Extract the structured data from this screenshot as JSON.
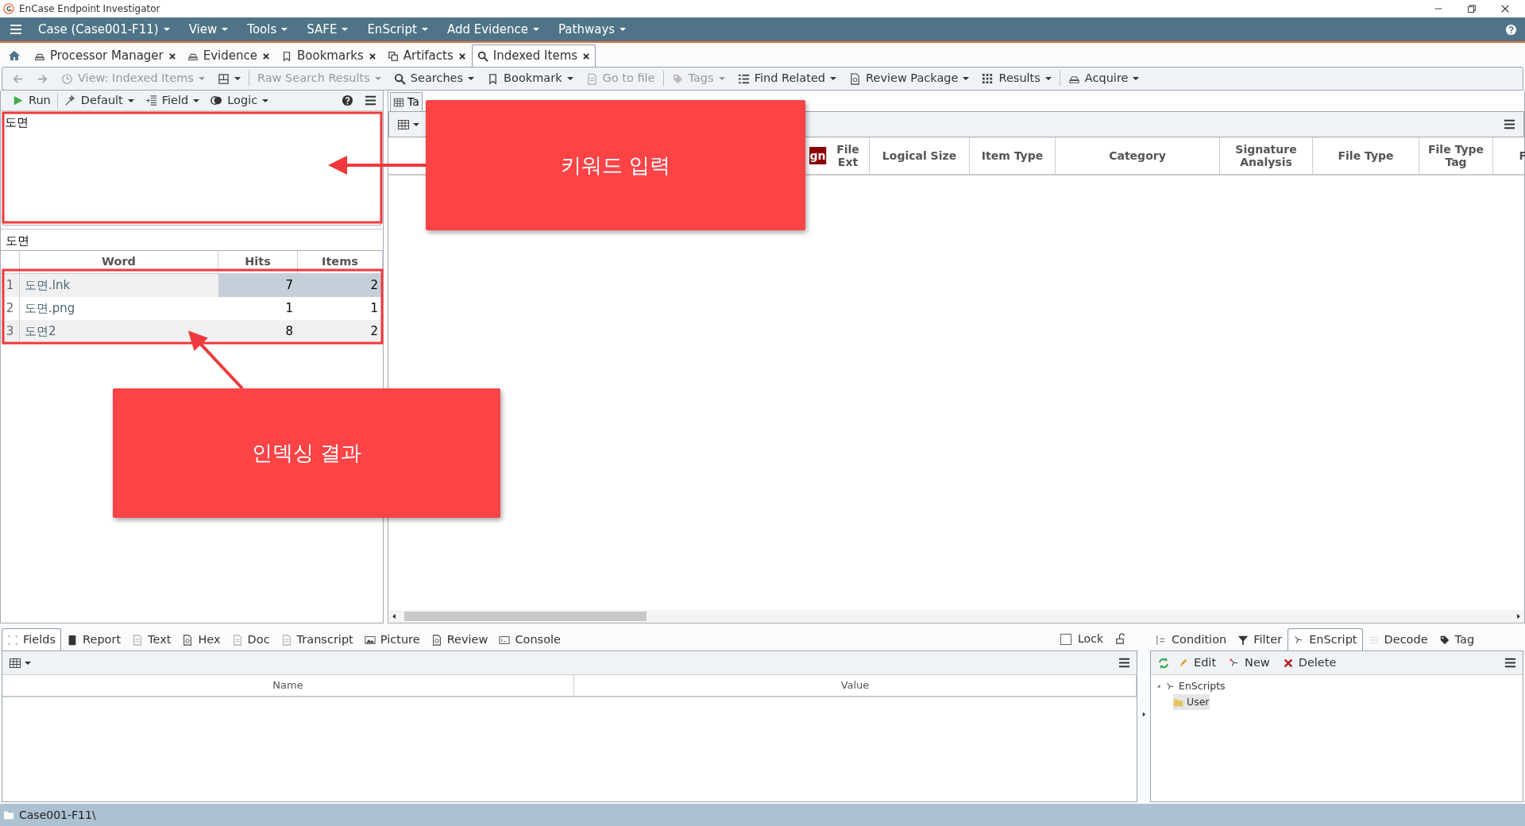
{
  "window": {
    "title": "EnCase Endpoint Investigator"
  },
  "menu": [
    "Case (Case001-F11)",
    "View",
    "Tools",
    "SAFE",
    "EnScript",
    "Add Evidence",
    "Pathways"
  ],
  "tabs": [
    {
      "label": "Processor Manager",
      "selected": false
    },
    {
      "label": "Evidence",
      "selected": false
    },
    {
      "label": "Bookmarks",
      "selected": false
    },
    {
      "label": "Artifacts",
      "selected": false
    },
    {
      "label": "Indexed Items",
      "selected": true
    }
  ],
  "toolbar": [
    {
      "kind": "icon",
      "disabled": true,
      "dropdown": false
    },
    {
      "kind": "icon",
      "disabled": true,
      "dropdown": false
    },
    {
      "kind": "button",
      "label": "View: Indexed Items",
      "disabled": true,
      "dropdown": true
    },
    {
      "kind": "icon",
      "disabled": false,
      "dropdown": true
    },
    {
      "kind": "separator"
    },
    {
      "kind": "button",
      "label": "Raw Search Results",
      "disabled": true,
      "dropdown": true
    },
    {
      "kind": "button",
      "label": "Searches",
      "disabled": false,
      "dropdown": true
    },
    {
      "kind": "button",
      "label": "Bookmark",
      "disabled": false,
      "dropdown": true
    },
    {
      "kind": "button",
      "label": "Go to file",
      "disabled": true,
      "dropdown": false
    },
    {
      "kind": "separator"
    },
    {
      "kind": "button",
      "label": "Tags",
      "disabled": true,
      "dropdown": true
    },
    {
      "kind": "button",
      "label": "Find Related",
      "disabled": false,
      "dropdown": true
    },
    {
      "kind": "button",
      "label": "Review Package",
      "disabled": false,
      "dropdown": true
    },
    {
      "kind": "button",
      "label": "Results",
      "disabled": false,
      "dropdown": true
    },
    {
      "kind": "separator"
    },
    {
      "kind": "button",
      "label": "Acquire",
      "disabled": false,
      "dropdown": true
    }
  ],
  "search_panel": {
    "toolbar": [
      {
        "label": "Run",
        "dropdown": false
      },
      {
        "label": "Default",
        "dropdown": true
      },
      {
        "label": "Field",
        "dropdown": true
      },
      {
        "label": "Logic",
        "dropdown": true
      }
    ],
    "query": "도면",
    "result_term": "도면",
    "columns": [
      "Word",
      "Hits",
      "Items"
    ],
    "rows": [
      {
        "number": "1",
        "word": "도면.lnk",
        "hits": "7",
        "items": "2",
        "selected": true
      },
      {
        "number": "2",
        "word": "도면.png",
        "hits": "1",
        "items": "1",
        "selected": false
      },
      {
        "number": "3",
        "word": "도면2",
        "hits": "8",
        "items": "2",
        "selected": false
      }
    ]
  },
  "view_tabs": [
    {
      "label": "Ta",
      "selected": true
    }
  ],
  "table": {
    "columns": [
      {
        "label": "gn",
        "highlighted": true
      },
      {
        "label": "File Ext",
        "highlighted": false
      },
      {
        "label": "Logical Size",
        "highlighted": false
      },
      {
        "label": "Item Type",
        "highlighted": false
      },
      {
        "label": "Category",
        "highlighted": false
      },
      {
        "label": "Signature Analysis",
        "highlighted": false
      },
      {
        "label": "File Type",
        "highlighted": false
      },
      {
        "label": "File Type Tag",
        "highlighted": false
      },
      {
        "label": "F",
        "highlighted": false
      }
    ]
  },
  "detail_tabs": [
    {
      "label": "Fields",
      "selected": true
    },
    {
      "label": "Report",
      "selected": false
    },
    {
      "label": "Text",
      "selected": false
    },
    {
      "label": "Hex",
      "selected": false
    },
    {
      "label": "Doc",
      "selected": false
    },
    {
      "label": "Transcript",
      "selected": false
    },
    {
      "label": "Picture",
      "selected": false
    },
    {
      "label": "Review",
      "selected": false
    },
    {
      "label": "Console",
      "selected": false
    }
  ],
  "lock": {
    "label": "Lock",
    "checked": false
  },
  "fields_table": {
    "columns": [
      "Name",
      "Value"
    ]
  },
  "side_tabs": [
    {
      "label": "Condition",
      "selected": false
    },
    {
      "label": "Filter",
      "selected": false
    },
    {
      "label": "EnScript",
      "selected": true
    },
    {
      "label": "Decode",
      "selected": false
    },
    {
      "label": "Tag",
      "selected": false
    }
  ],
  "side_toolbar": [
    "Edit",
    "New",
    "Delete"
  ],
  "tree": [
    {
      "label": "EnScripts",
      "expanded": true,
      "selected": false,
      "children": [
        {
          "label": "User",
          "selected": true
        }
      ]
    }
  ],
  "status_bar": "Case001-F11\\",
  "annotations": [
    {
      "text": "키워드 입력"
    },
    {
      "text": "인덱싱 결과"
    }
  ]
}
